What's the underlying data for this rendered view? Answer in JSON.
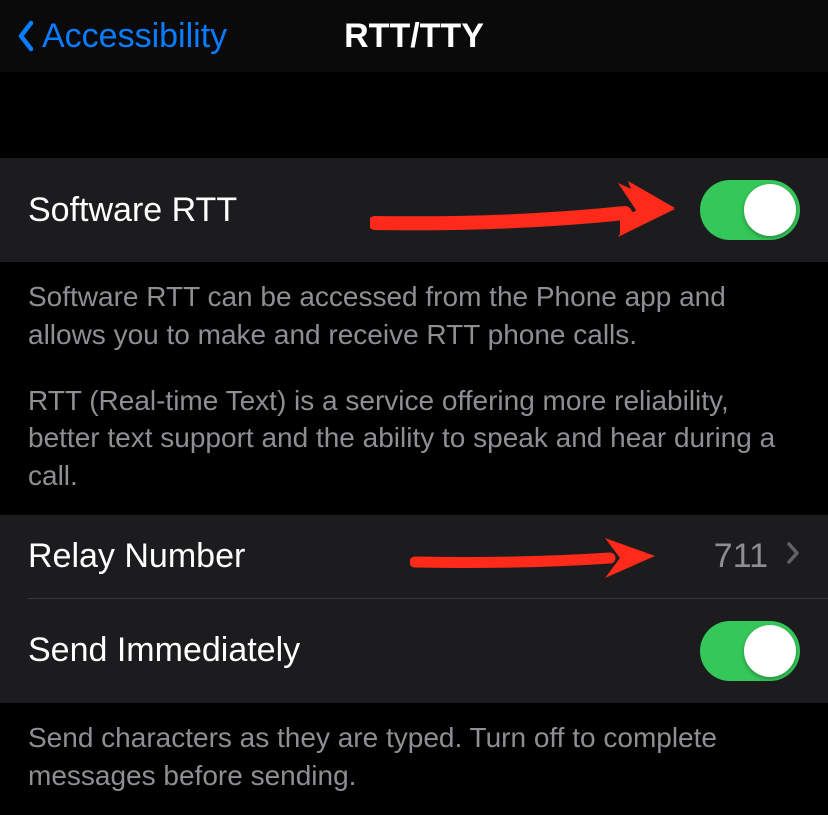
{
  "navbar": {
    "back_label": "Accessibility",
    "title": "RTT/TTY"
  },
  "sections": {
    "software_rtt": {
      "label": "Software RTT",
      "footer_p1": "Software RTT can be accessed from the Phone app and allows you to make and receive RTT phone calls.",
      "footer_p2": "RTT (Real-time Text) is a service offering more reliability, better text support and the ability to speak and hear during a call.",
      "toggle_on": true
    },
    "relay_number": {
      "label": "Relay Number",
      "value": "711"
    },
    "send_immediately": {
      "label": "Send Immediately",
      "footer": "Send characters as they are typed. Turn off to complete messages before sending.",
      "toggle_on": true
    }
  },
  "colors": {
    "accent": "#0a7cff",
    "toggle_on": "#34c759"
  }
}
